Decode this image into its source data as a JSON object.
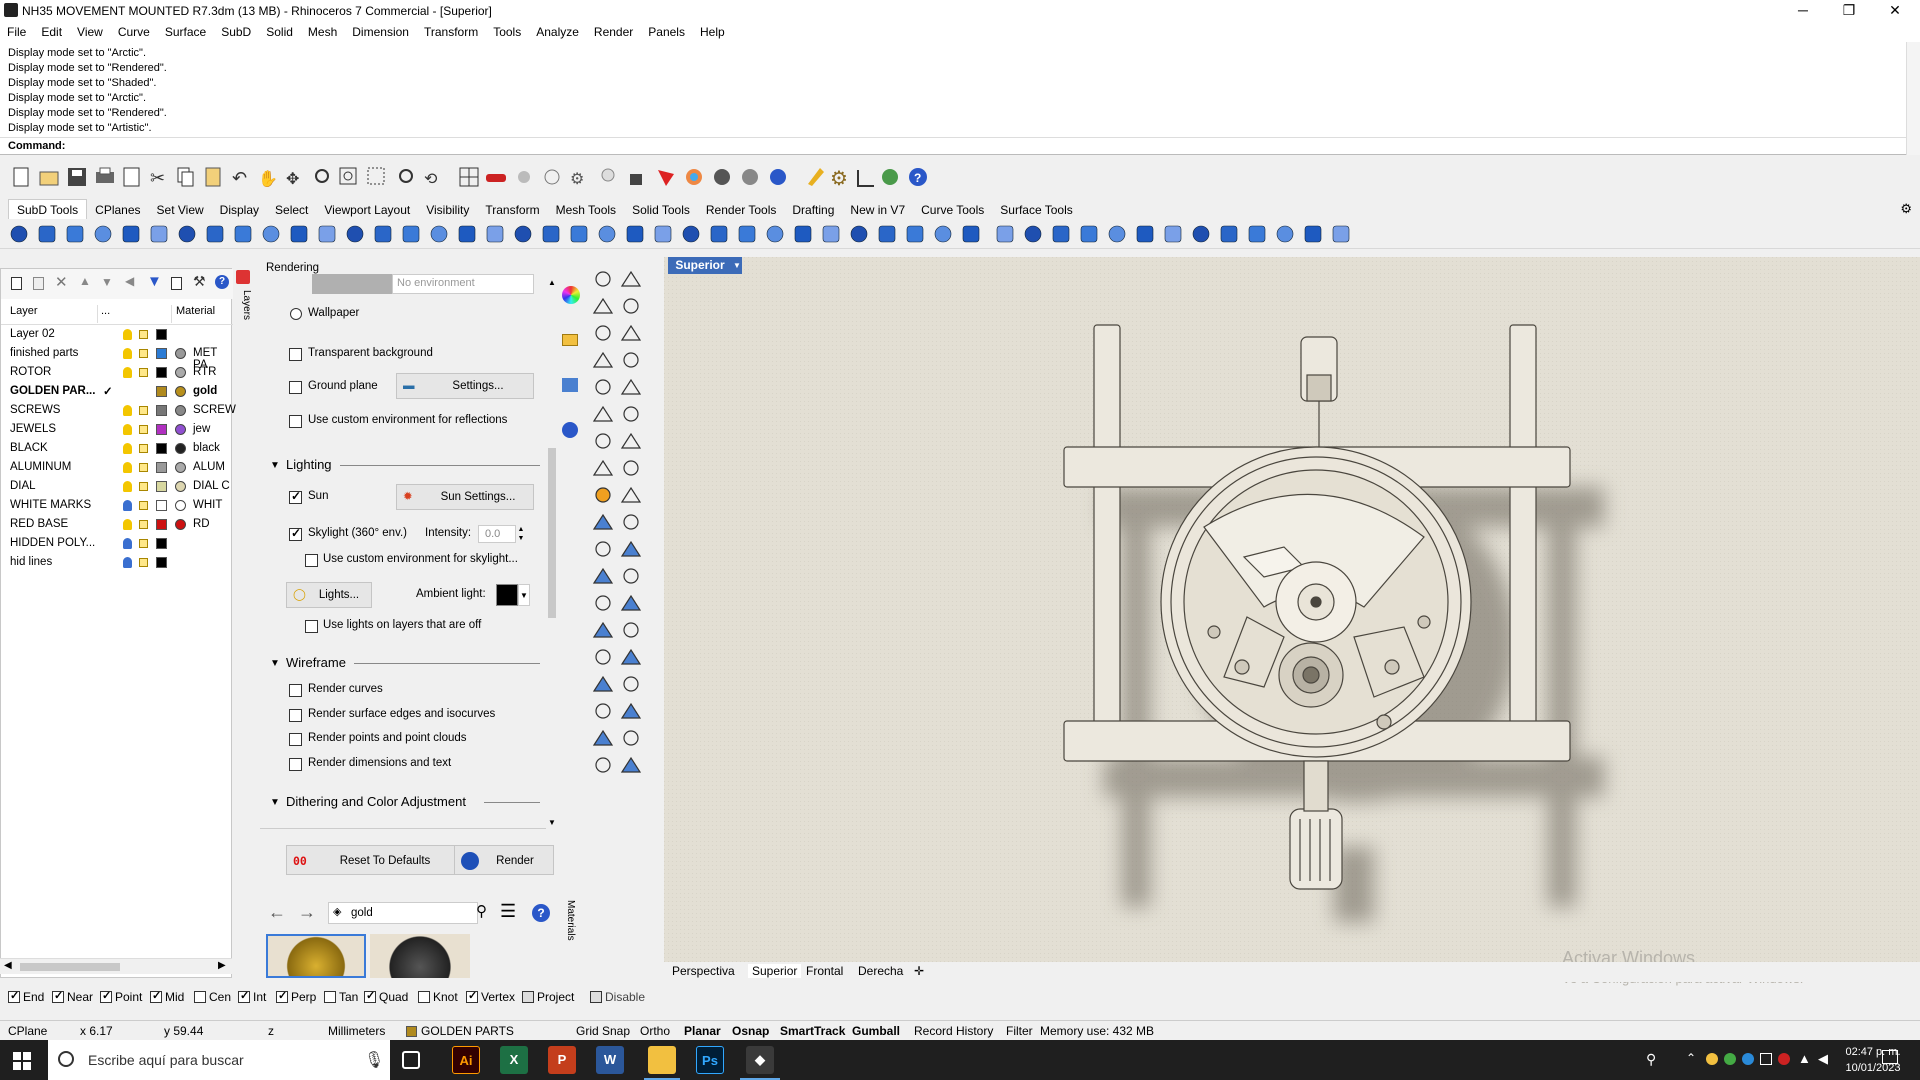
{
  "window": {
    "title": "NH35 MOVEMENT MOUNTED R7.3dm (13 MB) - Rhinoceros 7 Commercial - [Superior]",
    "minimize": "─",
    "maximize": "❐",
    "close": "✕"
  },
  "menu": [
    "File",
    "Edit",
    "View",
    "Curve",
    "Surface",
    "SubD",
    "Solid",
    "Mesh",
    "Dimension",
    "Transform",
    "Tools",
    "Analyze",
    "Render",
    "Panels",
    "Help"
  ],
  "command_history": [
    "Display mode set to \"Arctic\".",
    "Display mode set to \"Rendered\".",
    "Display mode set to \"Shaded\".",
    "Display mode set to \"Arctic\".",
    "Display mode set to \"Rendered\".",
    "Display mode set to \"Artistic\"."
  ],
  "command_prompt": "Command:",
  "toolbar_tabs": [
    "SubD Tools",
    "CPlanes",
    "Set View",
    "Display",
    "Select",
    "Viewport Layout",
    "Visibility",
    "Transform",
    "Mesh Tools",
    "Solid Tools",
    "Render Tools",
    "Drafting",
    "New in V7",
    "Curve Tools",
    "Surface Tools"
  ],
  "layers": {
    "col_layer": "Layer",
    "col_dots": "...",
    "col_material": "Material",
    "rows": [
      {
        "name": "Layer 02",
        "color": "#000000",
        "material": "",
        "matcolor": ""
      },
      {
        "name": "finished parts",
        "color": "#2b7bd4",
        "material": "MET PA",
        "matcolor": "#999999"
      },
      {
        "name": "ROTOR",
        "color": "#000000",
        "material": "RTR",
        "matcolor": "#aaaaaa"
      },
      {
        "name": "GOLDEN PAR...",
        "color": "#b08a1e",
        "material": "gold",
        "matcolor": "#b8901c",
        "current": true,
        "check": "✓"
      },
      {
        "name": "SCREWS",
        "color": "#777777",
        "material": "SCREW",
        "matcolor": "#888888"
      },
      {
        "name": "JEWELS",
        "color": "#b030c0",
        "material": "jew",
        "matcolor": "#9050d0"
      },
      {
        "name": "BLACK",
        "color": "#000000",
        "material": "black",
        "matcolor": "#222222"
      },
      {
        "name": "ALUMINUM",
        "color": "#999999",
        "material": "ALUM",
        "matcolor": "#aaaaaa"
      },
      {
        "name": "DIAL",
        "color": "#d8d8a0",
        "material": "DIAL C",
        "matcolor": "#ddd6b0"
      },
      {
        "name": "WHITE MARKS",
        "color": "#ffffff",
        "material": "WHIT",
        "matcolor": "#ffffff"
      },
      {
        "name": "RED BASE",
        "color": "#cc1111",
        "material": "RD",
        "matcolor": "#cc1111"
      },
      {
        "name": "HIDDEN POLY...",
        "color": "#000000",
        "material": "",
        "matcolor": ""
      },
      {
        "name": "hid lines",
        "color": "#000000",
        "material": "",
        "matcolor": ""
      }
    ]
  },
  "side_tabs": [
    "Layers",
    "Materials"
  ],
  "rendering": {
    "title": "Rendering",
    "env_value": "No environment",
    "wallpaper": "Wallpaper",
    "transparent_bg": "Transparent background",
    "ground_plane": "Ground plane",
    "settings": "Settings...",
    "custom_env_reflections": "Use custom environment for reflections",
    "lighting_header": "Lighting",
    "sun": "Sun",
    "sun_settings": "Sun Settings...",
    "skylight": "Skylight (360° env.)",
    "intensity_label": "Intensity:",
    "intensity_value": "0.0",
    "custom_env_skylight": "Use custom environment for skylight...",
    "lights_btn": "Lights...",
    "ambient_label": "Ambient light:",
    "lights_off_layers": "Use lights on layers that are off",
    "wireframe_header": "Wireframe",
    "render_curves": "Render curves",
    "render_edges": "Render surface edges and isocurves",
    "render_points": "Render points and point clouds",
    "render_dims": "Render dimensions and text",
    "dither_header": "Dithering and Color Adjustment",
    "reset_btn": "Reset To Defaults",
    "render_btn": "Render",
    "reset_glyph": "00"
  },
  "materials": {
    "search_value": "gold"
  },
  "viewport": {
    "label": "Superior",
    "tabs": [
      "Perspectiva",
      "Superior",
      "Frontal",
      "Derecha"
    ],
    "activate_line1": "Activar Windows",
    "activate_line2": "Ve a Configuración para activar Windows."
  },
  "osnaps": [
    {
      "label": "End",
      "on": true
    },
    {
      "label": "Near",
      "on": true
    },
    {
      "label": "Point",
      "on": true
    },
    {
      "label": "Mid",
      "on": true
    },
    {
      "label": "Cen",
      "on": false
    },
    {
      "label": "Int",
      "on": true
    },
    {
      "label": "Perp",
      "on": true
    },
    {
      "label": "Tan",
      "on": false
    },
    {
      "label": "Quad",
      "on": true
    },
    {
      "label": "Knot",
      "on": false
    },
    {
      "label": "Vertex",
      "on": true
    },
    {
      "label": "Project",
      "on": false
    },
    {
      "label": "Disable",
      "on": false
    }
  ],
  "status": {
    "cplane": "CPlane",
    "x": "x 6.17",
    "y": "y 59.44",
    "z": "z",
    "units": "Millimeters",
    "layer": "GOLDEN PARTS",
    "grid_snap": "Grid Snap",
    "ortho": "Ortho",
    "planar": "Planar",
    "osnap": "Osnap",
    "smarttrack": "SmartTrack",
    "gumball": "Gumball",
    "record_history": "Record History",
    "filter": "Filter",
    "memory": "Memory use: 432 MB"
  },
  "taskbar": {
    "search_placeholder": "Escribe aquí para buscar",
    "time": "02:47 p. m.",
    "date": "10/01/2023"
  }
}
